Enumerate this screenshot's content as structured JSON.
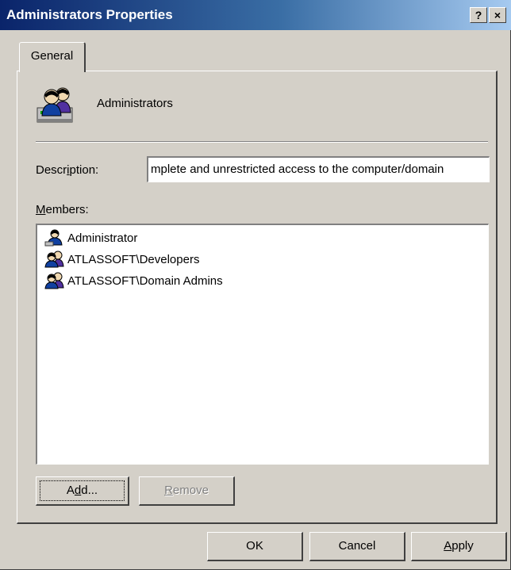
{
  "window": {
    "title": "Administrators Properties",
    "help_label": "?",
    "close_label": "×"
  },
  "tabs": [
    {
      "label": "General",
      "selected": true
    }
  ],
  "group": {
    "name": "Administrators",
    "icon": "users-group-icon"
  },
  "description": {
    "label_prefix": "Descr",
    "label_accel": "i",
    "label_suffix": "ption:",
    "value": "mplete and unrestricted access to the computer/domain"
  },
  "members": {
    "label_accel": "M",
    "label_suffix": "embers:",
    "items": [
      {
        "name": "Administrator",
        "icon": "user-icon"
      },
      {
        "name": "ATLASSOFT\\Developers",
        "icon": "users-group-icon"
      },
      {
        "name": "ATLASSOFT\\Domain Admins",
        "icon": "users-group-icon"
      }
    ]
  },
  "buttons": {
    "add": {
      "prefix": "A",
      "accel": "d",
      "suffix": "d..."
    },
    "remove": {
      "accel": "R",
      "suffix": "emove",
      "disabled": true
    },
    "ok": "OK",
    "cancel": "Cancel",
    "apply": {
      "accel": "A",
      "suffix": "pply"
    }
  }
}
